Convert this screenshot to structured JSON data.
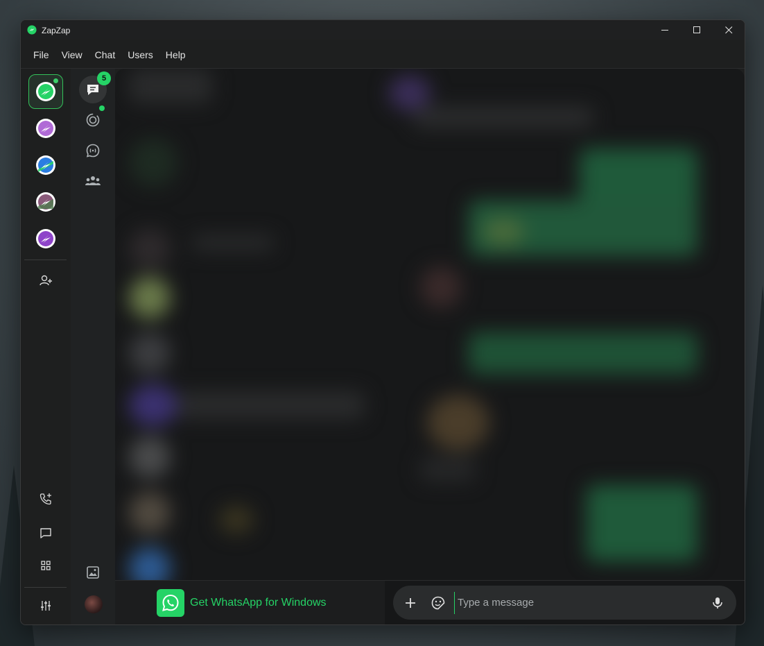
{
  "window": {
    "title": "ZapZap",
    "controls": [
      "minimize",
      "maximize",
      "close"
    ]
  },
  "menu": {
    "items": [
      "File",
      "View",
      "Chat",
      "Users",
      "Help"
    ]
  },
  "accounts": [
    {
      "name": "account-1",
      "active": true,
      "online": true,
      "colors": [
        "#25d366",
        "#ffffff"
      ]
    },
    {
      "name": "account-2",
      "active": false,
      "online": false,
      "colors": [
        "#b06ad6",
        "#ffffff"
      ]
    },
    {
      "name": "account-3",
      "active": false,
      "online": false,
      "colors": [
        "#2a7de1",
        "#25d366"
      ]
    },
    {
      "name": "account-4",
      "active": false,
      "online": false,
      "colors": [
        "#a05a8a",
        "#4a8a4a"
      ]
    },
    {
      "name": "account-5",
      "active": false,
      "online": false,
      "colors": [
        "#8e44c9",
        "#ffffff"
      ]
    }
  ],
  "nav": {
    "chats_badge": "5",
    "status_has_update": true
  },
  "bottom_bar": {
    "get_app_label": "Get WhatsApp for Windows"
  },
  "composer": {
    "placeholder": "Type a message"
  },
  "colors": {
    "accent": "#25d366",
    "window_bg": "#1e1f1f",
    "content_bg": "#171819"
  }
}
